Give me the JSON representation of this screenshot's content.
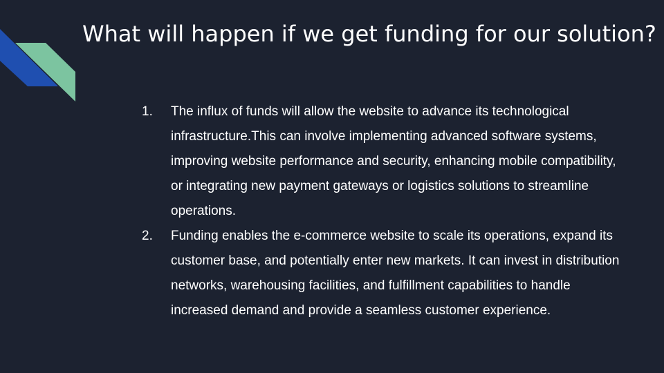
{
  "slide": {
    "title": "What will happen if we get funding for our solution?",
    "items": [
      {
        "number": "1.",
        "text": "The influx of funds will allow the website to advance its technological infrastructure.This can involve implementing advanced software systems, improving website performance and security, enhancing mobile compatibility, or integrating new payment gateways or logistics solutions to streamline operations."
      },
      {
        "number": "2.",
        "text": "Funding enables the e-commerce website to scale its operations, expand its customer base, and potentially enter new markets. It can invest in distribution networks, warehousing facilities, and fulfillment capabilities to handle increased demand and provide a seamless customer experience."
      }
    ]
  },
  "colors": {
    "background": "#1c2230",
    "accent_blue": "#1f4fb0",
    "accent_green": "#7cc4a0",
    "text": "#ffffff"
  }
}
